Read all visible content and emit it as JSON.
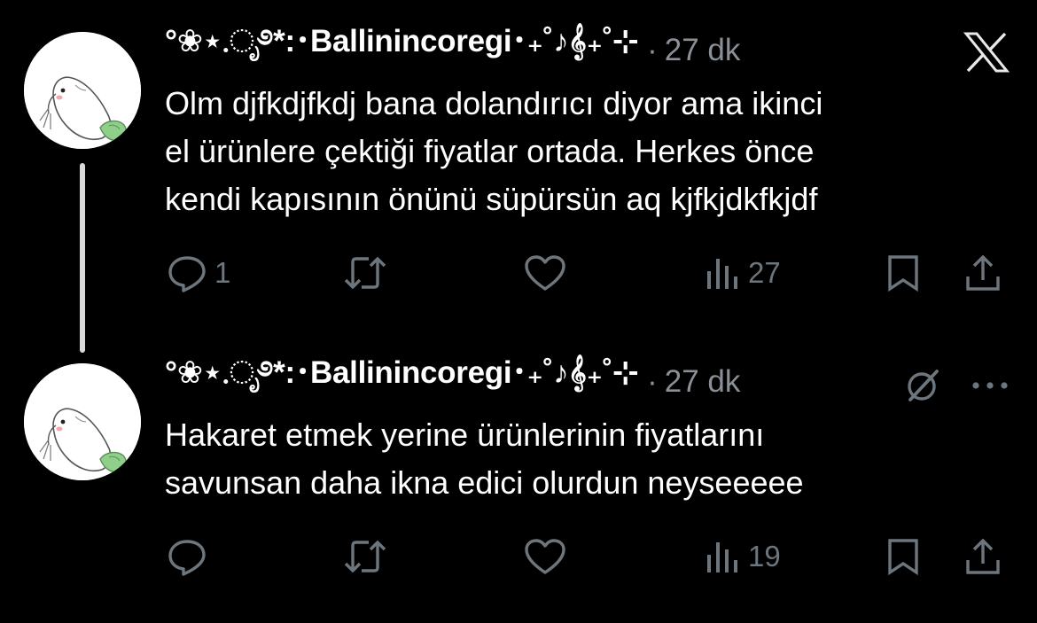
{
  "tweets": [
    {
      "display_name": "°❀⋆.ೃ࿔*:･Ballinincoregi･₊˚♪𝄞₊˚⊹",
      "separator": "·",
      "time": "27 dk",
      "text_lines": [
        "Olm djfkdjfkdj bana dolandırıcı diyor ama ikinci",
        "el ürünlere çektiği fiyatlar ortada. Herkes önce",
        "kendi kapısının önünü süpürsün aq kjfkjdkfkjdf"
      ],
      "reply_count": "1",
      "view_count": "27",
      "top_right_icon": "x-logo-icon"
    },
    {
      "display_name": "°❀⋆.ೃ࿔*:･Ballinincoregi･₊˚♪𝄞₊˚⊹",
      "separator": "·",
      "time": "27 dk",
      "text_lines": [
        "Hakaret etmek yerine ürünlerinin fiyatlarını",
        "savunsan daha ikna edici olurdun neyseeeee"
      ],
      "reply_count": "",
      "view_count": "19",
      "top_right_icons": [
        "grok-icon",
        "more-icon"
      ]
    }
  ],
  "icons": {
    "reply": "reply-icon",
    "retweet": "retweet-icon",
    "like": "heart-icon",
    "views": "views-icon",
    "bookmark": "bookmark-icon",
    "share": "share-icon"
  },
  "colors": {
    "background": "#000000",
    "text": "#ffffff",
    "secondary": "#8b9096",
    "icon": "#6e767d",
    "thread_line": "#d9d9d9"
  }
}
